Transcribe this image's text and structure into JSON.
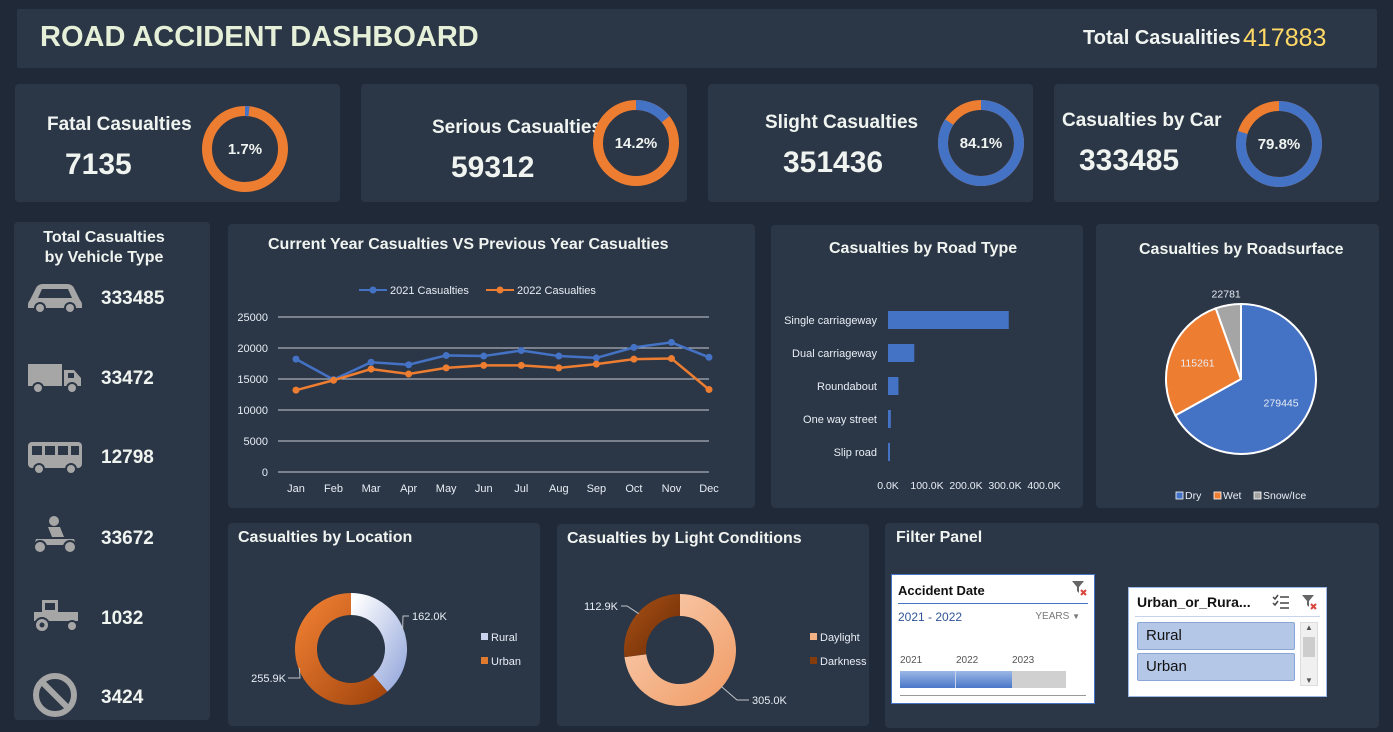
{
  "header": {
    "title": "ROAD ACCIDENT DASHBOARD",
    "total_label": "Total Casualities",
    "total_value": "417883"
  },
  "kpis": [
    {
      "label": "Fatal Casualties",
      "value": "7135",
      "pct_label": "1.7%",
      "pct": 0.017
    },
    {
      "label": "Serious Casualties",
      "value": "59312",
      "pct_label": "14.2%",
      "pct": 0.142
    },
    {
      "label": "Slight Casualties",
      "value": "351436",
      "pct_label": "84.1%",
      "pct": 0.841
    },
    {
      "label": "Casualties by Car",
      "value": "333485",
      "pct_label": "79.8%",
      "pct": 0.798
    }
  ],
  "vehicle": {
    "title_line1": "Total Casualties",
    "title_line2": "by Vehicle Type",
    "items": [
      {
        "icon": "car-icon",
        "value": "333485"
      },
      {
        "icon": "truck-icon",
        "value": "33472"
      },
      {
        "icon": "bus-icon",
        "value": "12798"
      },
      {
        "icon": "motorcycle-icon",
        "value": "33672"
      },
      {
        "icon": "tractor-icon",
        "value": "1032"
      },
      {
        "icon": "no-entry-icon",
        "value": "3424"
      }
    ]
  },
  "colors": {
    "blue": "#4472c4",
    "orange": "#ed7d31",
    "gray": "#a5a5a5",
    "gold": "#ffd966"
  },
  "filter": {
    "title": "Filter Panel",
    "date_slicer": {
      "title": "Accident Date",
      "range": "2021 - 2022",
      "unit": "YEARS",
      "years": [
        "2021",
        "2022",
        "2023"
      ]
    },
    "location_slicer": {
      "title": "Urban_or_Rura...",
      "items": [
        "Rural",
        "Urban"
      ]
    }
  },
  "chart_data": [
    {
      "type": "line",
      "title": "Current Year Casualties VS Previous Year Casualties",
      "categories": [
        "Jan",
        "Feb",
        "Mar",
        "Apr",
        "May",
        "Jun",
        "Jul",
        "Aug",
        "Sep",
        "Oct",
        "Nov",
        "Dec"
      ],
      "series": [
        {
          "name": "2021 Casualties",
          "values": [
            18200,
            14900,
            17700,
            17300,
            18800,
            18700,
            19600,
            18700,
            18400,
            20100,
            20900,
            18500
          ]
        },
        {
          "name": "2022 Casualties",
          "values": [
            13200,
            14800,
            16600,
            15800,
            16800,
            17200,
            17200,
            16800,
            17400,
            18200,
            18300,
            13300
          ]
        }
      ],
      "ylim": [
        0,
        25000
      ],
      "yticks": [
        "0",
        "5000",
        "10000",
        "15000",
        "20000",
        "25000"
      ],
      "legend": "top"
    },
    {
      "type": "bar",
      "orientation": "horizontal",
      "title": "Casualties by Road Type",
      "categories": [
        "Single carriageway",
        "Dual carriageway",
        "Roundabout",
        "One way street",
        "Slip road"
      ],
      "values": [
        309698,
        67373,
        26828,
        7389,
        5034
      ],
      "xlim": [
        0,
        400000
      ],
      "xticks": [
        "0.0K",
        "100.0K",
        "200.0K",
        "300.0K",
        "400.0K"
      ]
    },
    {
      "type": "pie",
      "title": "Casualties by Roadsurface",
      "labels": [
        "Dry",
        "Wet",
        "Snow/Ice"
      ],
      "values": [
        279445,
        115261,
        22781
      ],
      "legend": "bottom"
    },
    {
      "type": "pie",
      "subtype": "donut",
      "title": "Casualties by Location",
      "labels": [
        "Rural",
        "Urban"
      ],
      "values": [
        162.0,
        255.9
      ],
      "value_labels": [
        "162.0K",
        "255.9K"
      ],
      "legend": "right"
    },
    {
      "type": "pie",
      "subtype": "donut",
      "title": "Casualties by Light Conditions",
      "labels": [
        "Daylight",
        "Darkness"
      ],
      "values": [
        305.0,
        112.9
      ],
      "value_labels": [
        "305.0K",
        "112.9K"
      ],
      "legend": "right"
    }
  ]
}
